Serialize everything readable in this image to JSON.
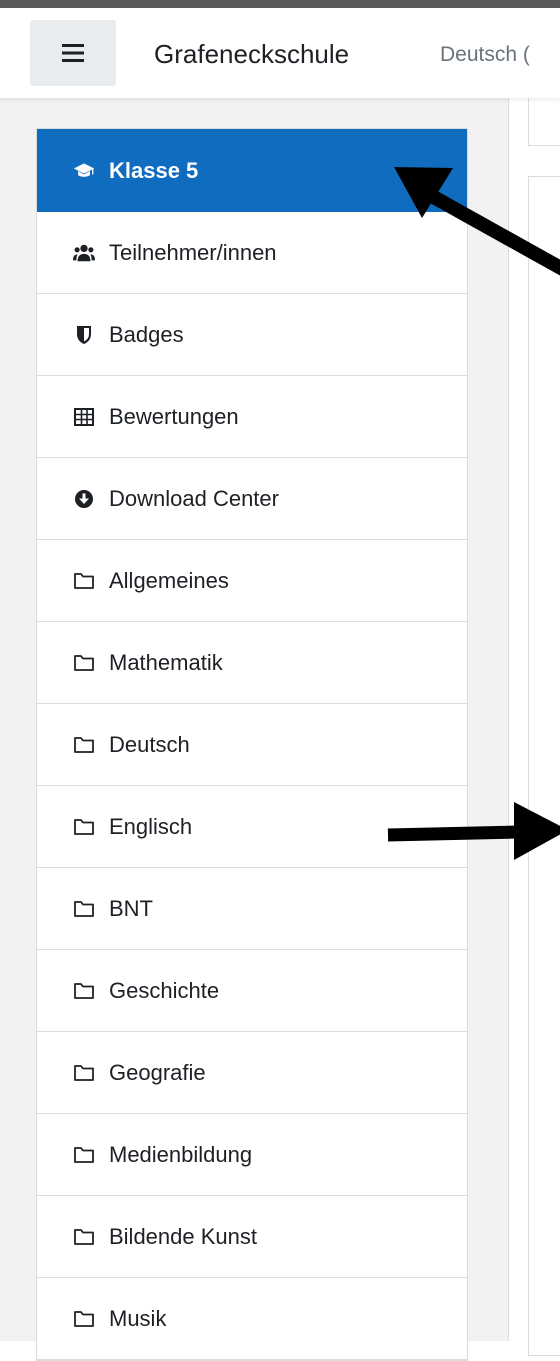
{
  "header": {
    "menu_icon": "hamburger-icon",
    "site_name": "Grafeneckschule",
    "language": "Deutsch (",
    "colors": {
      "topline": "#5a5a5a",
      "hamburger_bg": "#e9ecef"
    }
  },
  "nav": {
    "active_color": "#0f6cbf",
    "items": [
      {
        "label": "Klasse 5",
        "icon": "graduation-cap-icon",
        "active": true
      },
      {
        "label": "Teilnehmer/innen",
        "icon": "users-icon"
      },
      {
        "label": "Badges",
        "icon": "shield-icon"
      },
      {
        "label": "Bewertungen",
        "icon": "table-icon"
      },
      {
        "label": "Download Center",
        "icon": "download-circle-icon"
      },
      {
        "label": "Allgemeines",
        "icon": "folder-icon"
      },
      {
        "label": "Mathematik",
        "icon": "folder-icon"
      },
      {
        "label": "Deutsch",
        "icon": "folder-icon"
      },
      {
        "label": "Englisch",
        "icon": "folder-icon"
      },
      {
        "label": "BNT",
        "icon": "folder-icon"
      },
      {
        "label": "Geschichte",
        "icon": "folder-icon"
      },
      {
        "label": "Geografie",
        "icon": "folder-icon"
      },
      {
        "label": "Medienbildung",
        "icon": "folder-icon"
      },
      {
        "label": "Bildende Kunst",
        "icon": "folder-icon"
      },
      {
        "label": "Musik",
        "icon": "folder-icon"
      }
    ]
  },
  "annotations": {
    "arrow_color": "#000000",
    "arrow_count": 2
  }
}
